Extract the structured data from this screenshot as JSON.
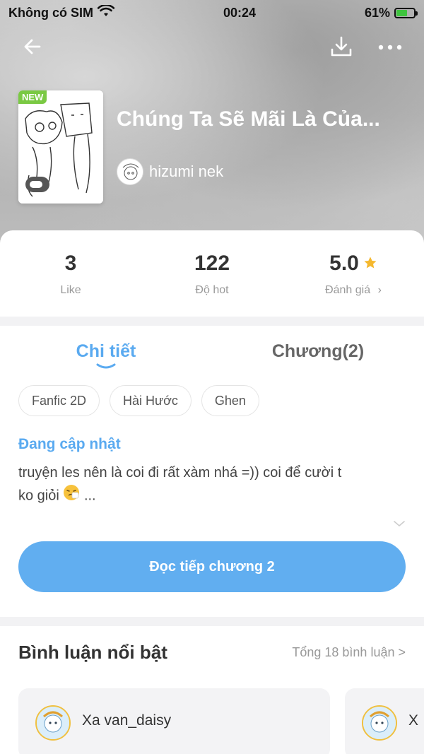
{
  "status_bar": {
    "carrier": "Không có SIM",
    "time": "00:24",
    "battery": "61%",
    "battery_level": 0.61
  },
  "nav": {
    "back_icon": "back-arrow-icon",
    "download_icon": "download-icon",
    "more_icon": "more-icon"
  },
  "story": {
    "badge": "NEW",
    "title": "Chúng Ta Sẽ Mãi Là Của...",
    "author": "hizumi nek"
  },
  "stats": [
    {
      "value": "3",
      "label": "Like"
    },
    {
      "value": "122",
      "label": "Độ hot"
    },
    {
      "value": "5.0",
      "label": "Đánh giá",
      "chevron": "›"
    }
  ],
  "tabs": {
    "detail": "Chi tiết",
    "chapters": "Chương(2)"
  },
  "tags": [
    "Fanfic 2D",
    "Hài Hước",
    "Ghen"
  ],
  "detail": {
    "status": "Đang cập nhật",
    "description_line1": "truyện les nên là coi đi rất xàm nhá =)) coi để cười t",
    "description_line2": "ko giỏi",
    "ellipsis": "...",
    "read_button": "Đọc tiếp chương 2"
  },
  "comments": {
    "title": "Bình luận nổi bật",
    "total": "Tổng 18 bình luận >",
    "items": [
      {
        "name": "Xa van_daisy"
      },
      {
        "name": "X"
      }
    ]
  },
  "colors": {
    "accent": "#5aaaf0",
    "button": "#61aef0",
    "star": "#f5b82e",
    "new_badge": "#7ac943"
  }
}
